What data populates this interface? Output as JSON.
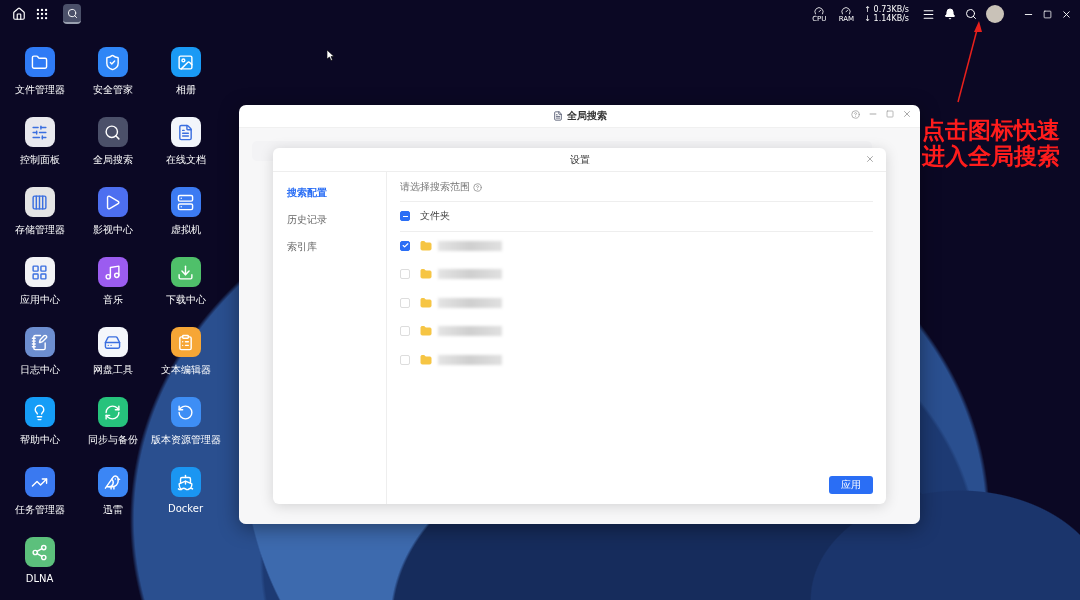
{
  "taskbar": {
    "running_apps": [
      {
        "kind": "search",
        "active": true
      }
    ]
  },
  "system_monitor": {
    "cpu_label": "CPU",
    "ram_label": "RAM",
    "upload": "↑ 0.73KB/s",
    "download": "↓ 1.14KB/s"
  },
  "desktop_apps": [
    {
      "label": "文件管理器",
      "kind": "folder",
      "color": "#2f7bf6"
    },
    {
      "label": "安全管家",
      "kind": "shield",
      "color": "#2f86f6"
    },
    {
      "label": "相册",
      "kind": "image",
      "color": "#1a9af5"
    },
    {
      "label": "控制面板",
      "kind": "sliders",
      "color": "#e9e9ee"
    },
    {
      "label": "全局搜索",
      "kind": "search",
      "color": "#4b5069"
    },
    {
      "label": "在线文档",
      "kind": "document",
      "color": "#f2f5fb"
    },
    {
      "label": "存储管理器",
      "kind": "storage",
      "color": "#e5e5e5"
    },
    {
      "label": "影视中心",
      "kind": "video",
      "color": "#4d6ff0"
    },
    {
      "label": "虚拟机",
      "kind": "server",
      "color": "#3c7bf2"
    },
    {
      "label": "应用中心",
      "kind": "apps",
      "color": "#f3f3f6"
    },
    {
      "label": "音乐",
      "kind": "music",
      "color": "#9b5cf0"
    },
    {
      "label": "下载中心",
      "kind": "download",
      "color": "#4fc06a"
    },
    {
      "label": "日志中心",
      "kind": "notebook",
      "color": "#6d8ed0"
    },
    {
      "label": "网盘工具",
      "kind": "drive",
      "color": "#f4f6fb"
    },
    {
      "label": "文本编辑器",
      "kind": "clipboard",
      "color": "#f6a636"
    },
    {
      "label": "帮助中心",
      "kind": "bulb",
      "color": "#159df7"
    },
    {
      "label": "同步与备份",
      "kind": "sync",
      "color": "#26c37c"
    },
    {
      "label": "版本资源管理器",
      "kind": "history",
      "color": "#3e8ef5"
    },
    {
      "label": "任务管理器",
      "kind": "chart",
      "color": "#3a79f0"
    },
    {
      "label": "迅雷",
      "kind": "bird",
      "color": "#3b86f5"
    },
    {
      "label": "Docker",
      "kind": "docker",
      "color": "#1a96f2"
    },
    {
      "label": "DLNA",
      "kind": "share",
      "color": "#5cc07c"
    }
  ],
  "window": {
    "title": "全局搜索"
  },
  "dialog": {
    "title": "设置",
    "nav": [
      {
        "label": "搜索配置",
        "selected": true
      },
      {
        "label": "历史记录",
        "selected": false
      },
      {
        "label": "索引库",
        "selected": false
      }
    ],
    "heading": "请选择搜索范围",
    "select_all": {
      "label": "文件夹",
      "indeterminate": true
    },
    "folders": [
      {
        "checked": true
      },
      {
        "checked": false
      },
      {
        "checked": false
      },
      {
        "checked": false
      },
      {
        "checked": false
      }
    ],
    "apply_button": "应用"
  },
  "annotation": {
    "lines": [
      "点击图标快速",
      "进入全局搜索"
    ]
  }
}
